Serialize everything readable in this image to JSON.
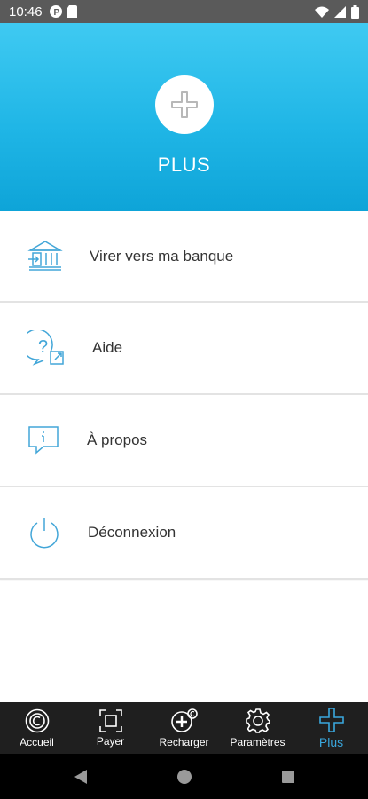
{
  "status_bar": {
    "time": "10:46"
  },
  "header": {
    "title": "PLUS"
  },
  "menu": {
    "items": [
      {
        "label": "Virer vers ma banque",
        "icon": "bank-icon"
      },
      {
        "label": "Aide",
        "icon": "help-icon"
      },
      {
        "label": "À propos",
        "icon": "info-icon"
      },
      {
        "label": "Déconnexion",
        "icon": "power-icon"
      }
    ]
  },
  "bottom_nav": {
    "items": [
      {
        "label": "Accueil",
        "icon": "home-coin-icon"
      },
      {
        "label": "Payer",
        "icon": "scan-icon"
      },
      {
        "label": "Recharger",
        "icon": "recharge-icon"
      },
      {
        "label": "Paramètres",
        "icon": "gear-icon"
      },
      {
        "label": "Plus",
        "icon": "plus-icon"
      }
    ],
    "active_index": 4
  },
  "colors": {
    "accent": "#3aa7dd",
    "header_top": "#3fcaf2",
    "header_bottom": "#0ea4d8",
    "nav_background": "#1f1f1f"
  }
}
